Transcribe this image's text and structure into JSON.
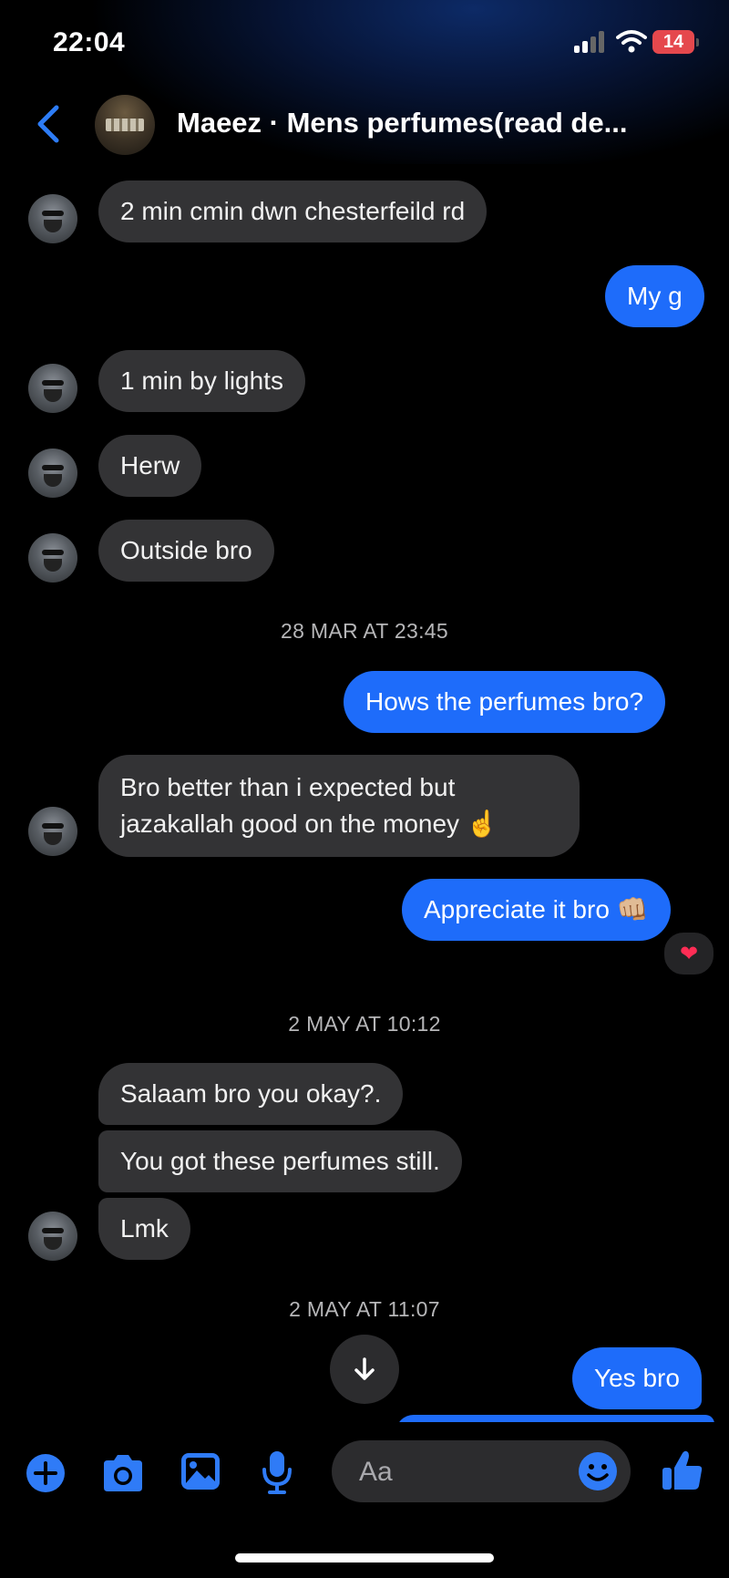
{
  "status": {
    "time": "22:04",
    "battery": "14"
  },
  "header": {
    "title": "Maeez · Mens perfumes(read de..."
  },
  "messages": [
    {
      "text": "2 min cmin dwn chesterfeild rd"
    },
    {
      "text": "My g"
    },
    {
      "text": "1 min by lights"
    },
    {
      "text": "Herw"
    },
    {
      "text": "Outside bro"
    },
    {
      "text": "Hows the perfumes bro?"
    },
    {
      "line1": "Bro better than i expected but",
      "line2": "jazakallah good on the money ☝️"
    },
    {
      "text": "Appreciate it bro 👊🏼"
    },
    {
      "text": "Salaam bro you okay?."
    },
    {
      "text": "You got these perfumes still."
    },
    {
      "text": "Lmk"
    },
    {
      "text": "Yes bro"
    }
  ],
  "timestamps": [
    "28 MAR AT 23:45",
    "2 MAY AT 10:12",
    "2 MAY AT 11:07"
  ],
  "reaction": "❤",
  "composer": {
    "placeholder": "Aa"
  },
  "colors": {
    "accent": "#1e6cfa",
    "incoming": "#333335",
    "background": "#000000"
  }
}
